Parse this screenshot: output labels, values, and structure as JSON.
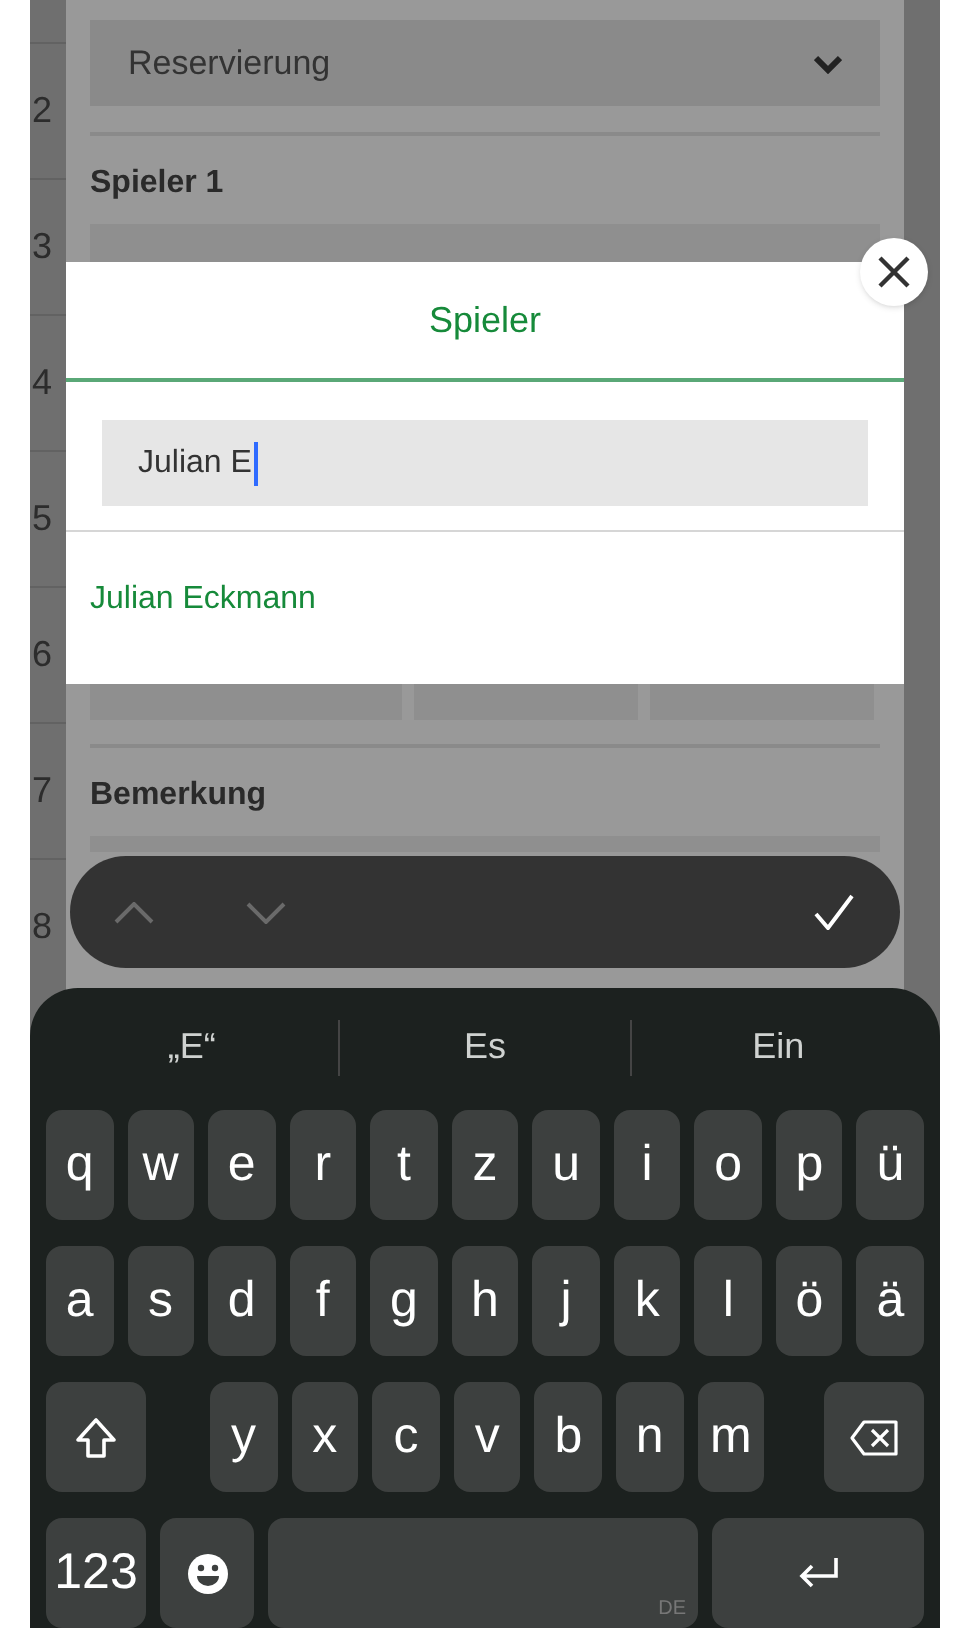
{
  "form": {
    "row_numbers": [
      "2",
      "3",
      "4",
      "5",
      "6",
      "7",
      "8"
    ],
    "type_select": "Reservierung",
    "player1_label": "Spieler 1",
    "remark_label": "Bemerkung"
  },
  "dialog": {
    "title": "Spieler",
    "search_value": "Julian E",
    "results": [
      "Julian Eckmann"
    ]
  },
  "keyboard": {
    "suggestions": [
      "„E“",
      "Es",
      "Ein"
    ],
    "top_letters": [
      "q",
      "w",
      "e",
      "r",
      "t",
      "z",
      "u",
      "i",
      "o",
      "p",
      "ü"
    ],
    "middle_letters": [
      "a",
      "s",
      "d",
      "f",
      "g",
      "h",
      "j",
      "k",
      "l",
      "ö",
      "ä"
    ],
    "bottom_letters": [
      "y",
      "x",
      "c",
      "v",
      "b",
      "n",
      "m"
    ],
    "numbers_key": "123",
    "language": "DE"
  }
}
